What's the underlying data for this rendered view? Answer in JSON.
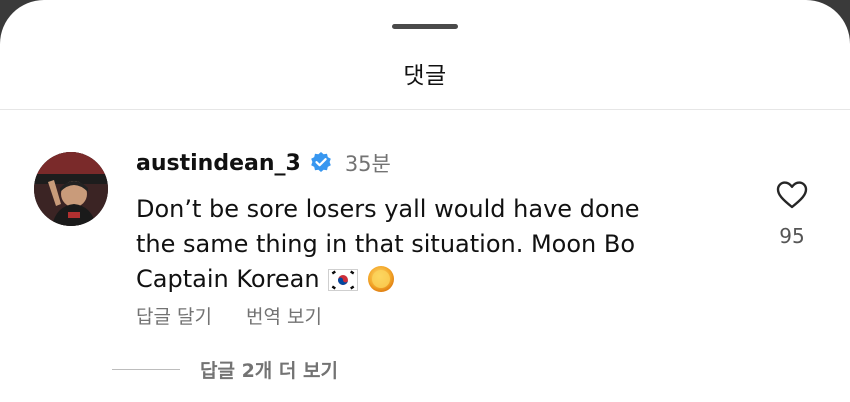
{
  "sheet": {
    "title": "댓글"
  },
  "comment": {
    "username": "austindean_3",
    "verified": true,
    "time": "35분",
    "text_line1": "Don’t be sore losers yall would have done",
    "text_line2": "the same thing in that situation. Moon Bo",
    "text_line3": "Captain Korean",
    "emojis": [
      "south-korea-flag",
      "sun-emoji"
    ],
    "reply_label": "답글 달기",
    "translate_label": "번역 보기",
    "like_count": "95"
  },
  "replies": {
    "more_label": "답글 2개 더 보기"
  },
  "colors": {
    "verified_blue": "#3897f0",
    "secondary_text": "#737373",
    "primary_text": "#111111"
  }
}
